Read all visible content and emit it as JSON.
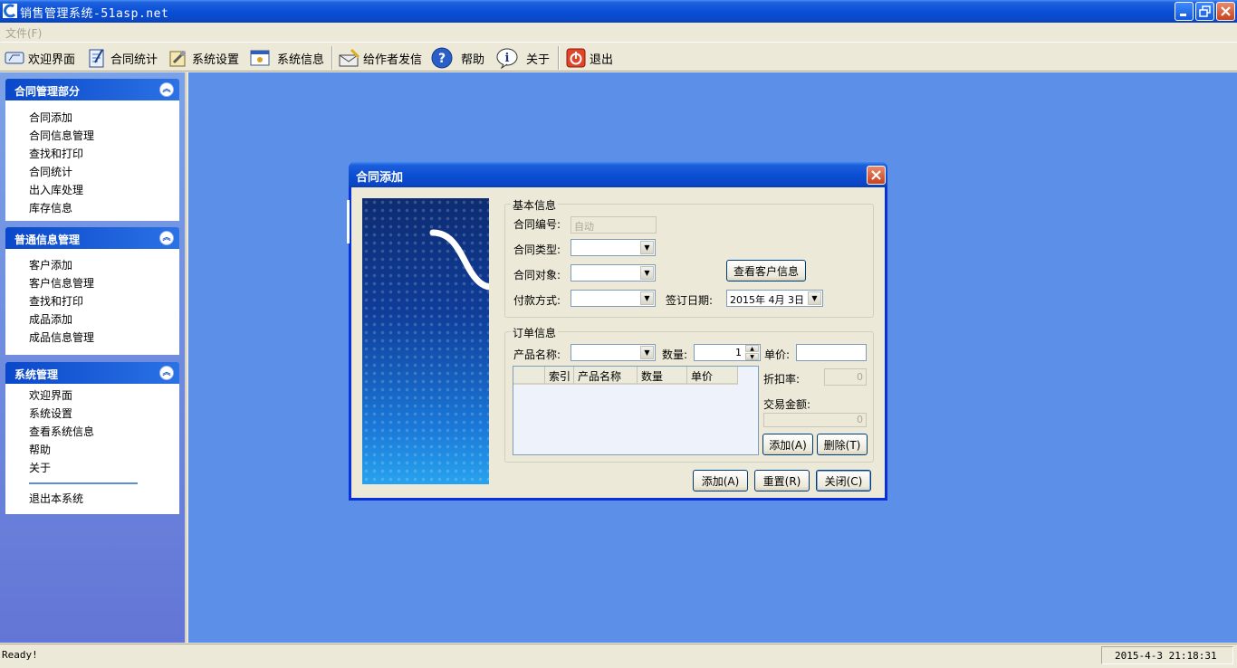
{
  "window": {
    "title": "销售管理系统-51asp.net"
  },
  "menu": {
    "file": "文件(F)"
  },
  "toolbar": {
    "welcome": "欢迎界面",
    "contract_stats": "合同统计",
    "system_settings": "系统设置",
    "system_info": "系统信息",
    "mail_author": "给作者发信",
    "help": "帮助",
    "about": "关于",
    "exit": "退出"
  },
  "sidebar": {
    "groups": [
      {
        "title": "合同管理部分",
        "items": [
          "合同添加",
          "合同信息管理",
          "查找和打印",
          "合同统计",
          "出入库处理",
          "库存信息"
        ]
      },
      {
        "title": "普通信息管理",
        "items": [
          "客户添加",
          "客户信息管理",
          "查找和打印",
          "成品添加",
          "成品信息管理"
        ]
      },
      {
        "title": "系统管理",
        "items": [
          "欢迎界面",
          "系统设置",
          "查看系统信息",
          "帮助",
          "关于",
          "退出本系统"
        ]
      }
    ]
  },
  "dialog": {
    "title": "合同添加",
    "basic_info": {
      "legend": "基本信息",
      "contract_no_label": "合同编号:",
      "contract_no_value": "自动",
      "contract_type_label": "合同类型:",
      "contract_target_label": "合同对象:",
      "payment_label": "付款方式:",
      "view_customer_button": "查看客户信息",
      "sign_date_label": "签订日期:",
      "sign_date_value": "2015年 4月 3日"
    },
    "order_info": {
      "legend": "订单信息",
      "product_name_label": "产品名称:",
      "quantity_label": "数量:",
      "quantity_value": "1",
      "unit_price_label": "单价:",
      "columns": [
        "",
        "索引",
        "产品名称",
        "数量",
        "单价"
      ],
      "discount_label": "折扣率:",
      "discount_value": "0",
      "amount_label": "交易金额:",
      "amount_value": "0",
      "add_row_button": "添加(A)",
      "delete_row_button": "删除(T)"
    },
    "buttons": {
      "add": "添加(A)",
      "reset": "重置(R)",
      "close": "关闭(C)"
    }
  },
  "status": {
    "left": "Ready!",
    "datetime": "2015-4-3 21:18:31"
  },
  "colors": {
    "titlebar": "#0a4fd6",
    "mdi_background": "#5b8fe8",
    "sidebar_header": "#0a48ca"
  }
}
